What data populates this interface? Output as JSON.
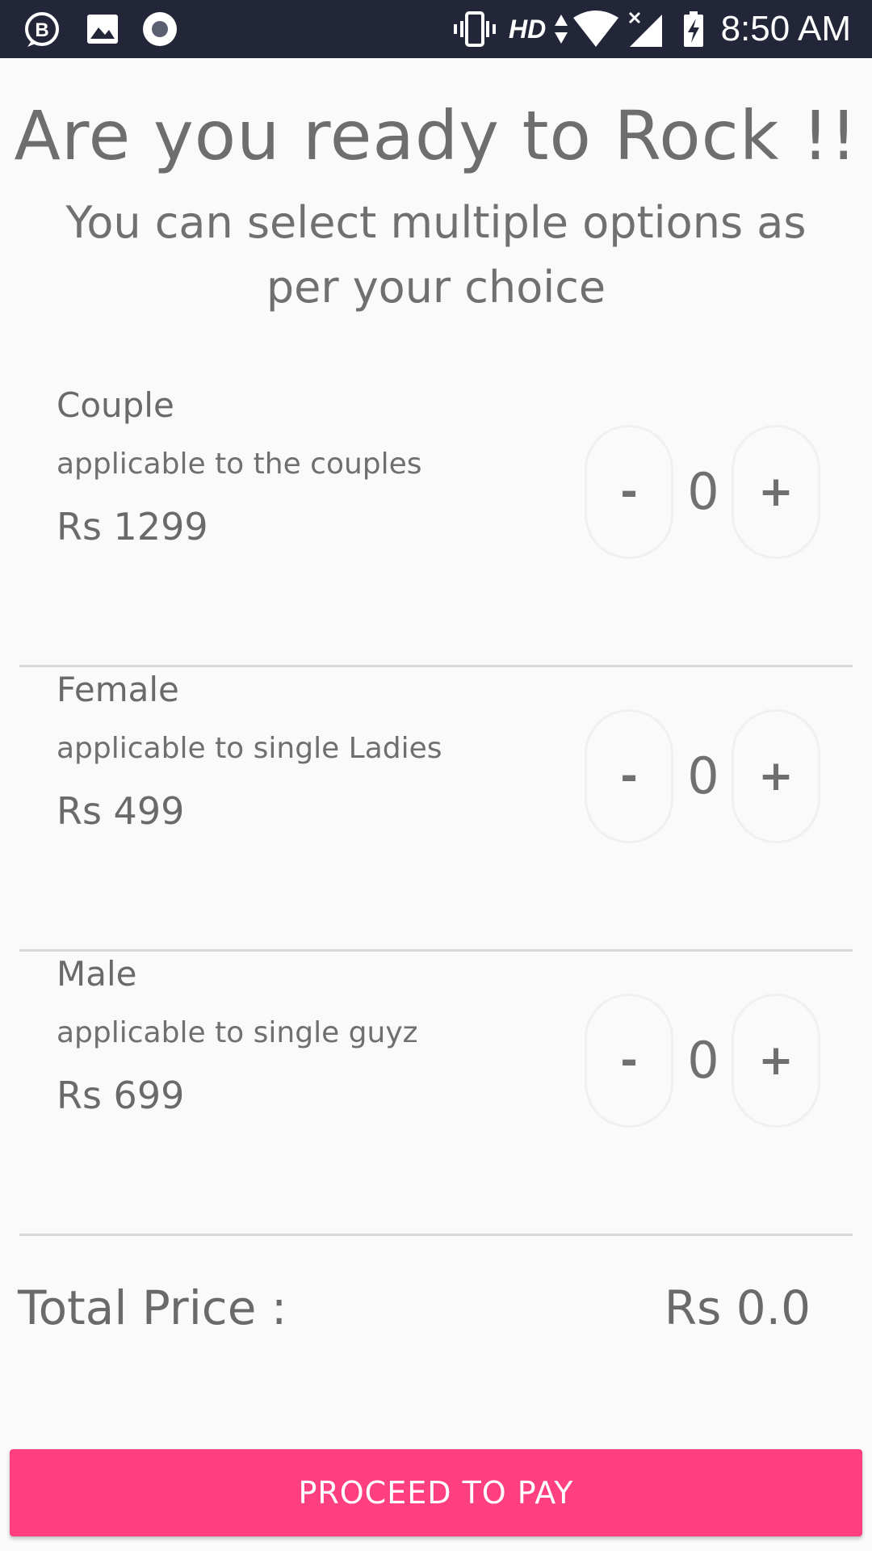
{
  "status_bar": {
    "time": "8:50 AM",
    "network_label": "HD",
    "icons": [
      "business-app-icon",
      "gallery-icon",
      "record-icon",
      "vibrate-icon",
      "data-arrows-icon",
      "wifi-icon",
      "signal-icon",
      "battery-charging-icon"
    ]
  },
  "header": {
    "title": "Are you ready to Rock !!",
    "subtitle": "You can select multiple options as per your choice"
  },
  "tickets": [
    {
      "name": "Couple",
      "description": "applicable to the couples",
      "price": "Rs 1299",
      "count": "0",
      "minus_label": "-",
      "plus_label": "+"
    },
    {
      "name": "Female",
      "description": "applicable to single Ladies",
      "price": "Rs 499",
      "count": "0",
      "minus_label": "-",
      "plus_label": "+"
    },
    {
      "name": "Male",
      "description": "applicable to single guyz",
      "price": "Rs 699",
      "count": "0",
      "minus_label": "-",
      "plus_label": "+"
    }
  ],
  "total": {
    "label": "Total Price :",
    "value": "Rs 0.0"
  },
  "proceed_button": {
    "label": "PROCEED TO PAY"
  },
  "colors": {
    "status_bar": "#232638",
    "background": "#fafafa",
    "accent": "#ff3f7f",
    "text": "#6f6f6f",
    "divider": "#d8d8d8"
  }
}
